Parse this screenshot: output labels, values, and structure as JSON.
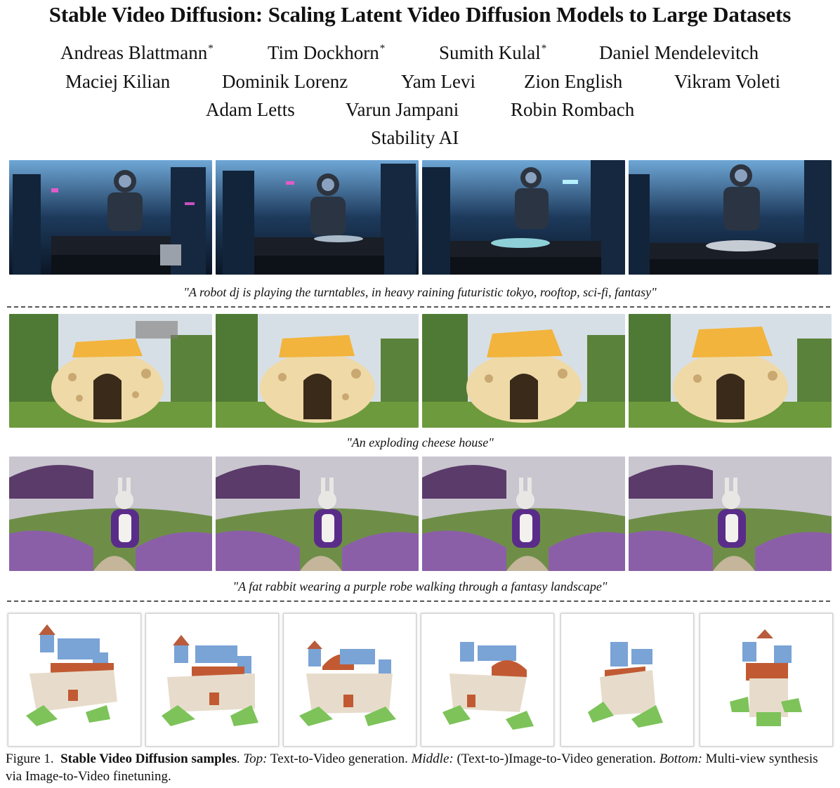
{
  "title": "Stable Video Diffusion: Scaling Latent Video Diffusion Models to Large Datasets",
  "authors": [
    {
      "name": "Andreas Blattmann",
      "mark": "*"
    },
    {
      "name": "Tim Dockhorn",
      "mark": "*"
    },
    {
      "name": "Sumith Kulal",
      "mark": "*"
    },
    {
      "name": "Daniel Mendelevitch",
      "mark": ""
    },
    {
      "name": "Maciej Kilian",
      "mark": ""
    },
    {
      "name": "Dominik Lorenz",
      "mark": ""
    },
    {
      "name": "Yam Levi",
      "mark": ""
    },
    {
      "name": "Zion English",
      "mark": ""
    },
    {
      "name": "Vikram Voleti",
      "mark": ""
    },
    {
      "name": "Adam Letts",
      "mark": ""
    },
    {
      "name": "Varun Jampani",
      "mark": ""
    },
    {
      "name": "Robin Rombach",
      "mark": ""
    }
  ],
  "affiliation": "Stability AI",
  "rows": [
    {
      "caption": "\"A robot dj is playing the turntables, in heavy raining futuristic tokyo, rooftop, sci-fi, fantasy\""
    },
    {
      "caption": "\"An exploding cheese house\""
    },
    {
      "caption": "\"A fat rabbit wearing a purple robe walking through a fantasy landscape\""
    }
  ],
  "figure_caption": {
    "label": "Figure 1.",
    "bold": "Stable Video Diffusion samples",
    "part1_key": "Top:",
    "part1_text": "Text-to-Video generation.",
    "part2_key": "Middle:",
    "part2_text": "(Text-to-)Image-to-Video generation.",
    "part3_key": "Bottom:",
    "part3_text": "Multi-view synthesis via Image-to-Video finetuning."
  }
}
